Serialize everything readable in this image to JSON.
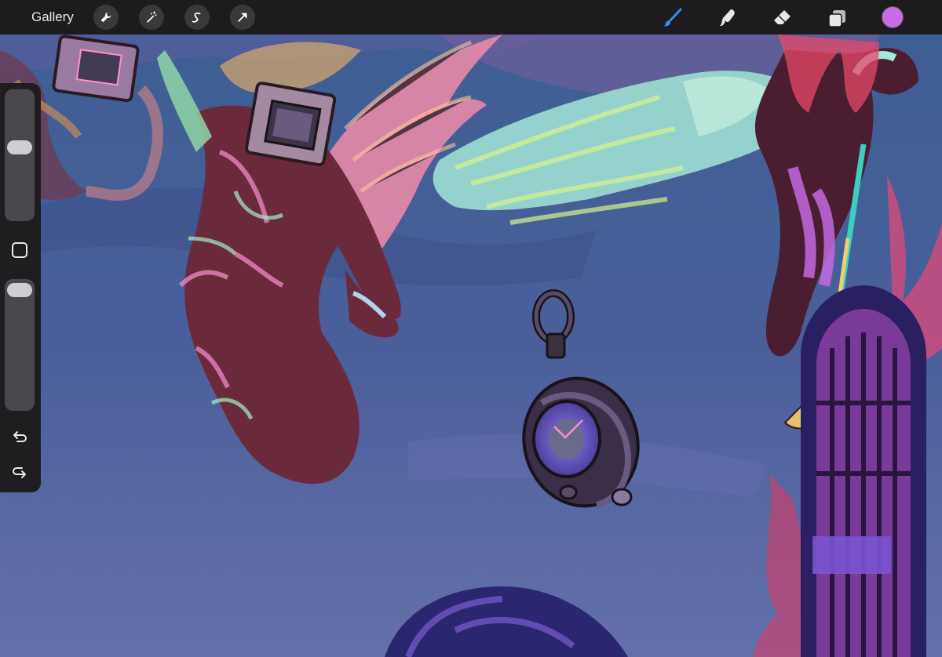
{
  "toolbar": {
    "gallery_label": "Gallery",
    "left_tools": [
      {
        "icon": "wrench-icon"
      },
      {
        "icon": "magic-wand-icon"
      },
      {
        "icon": "selection-s-icon"
      },
      {
        "icon": "transform-arrow-icon"
      }
    ],
    "right_tools": [
      {
        "icon": "brush-icon",
        "active": true
      },
      {
        "icon": "smudge-icon"
      },
      {
        "icon": "eraser-icon"
      },
      {
        "icon": "layers-icon"
      }
    ],
    "current_color": "#c86ce8"
  },
  "sidebar": {
    "brush_size_icon": "slider",
    "opacity_icon": "slider",
    "modify_icon": "square-icon",
    "undo_icon": "undo-icon",
    "redo_icon": "redo-icon"
  },
  "canvas": {
    "description_colors": {
      "sky": "#3d5a8a",
      "accent_pink": "#e86aa8",
      "accent_mint": "#a6f0c8",
      "clock_purple": "#7a5cf0"
    }
  }
}
